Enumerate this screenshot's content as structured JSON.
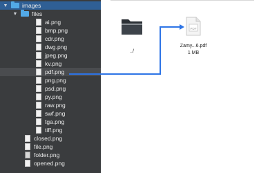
{
  "sidebar": {
    "folder_root": "images",
    "folder_files": "files",
    "files": [
      "ai.png",
      "bmp.png",
      "cdr.png",
      "dwg.png",
      "jpeg.png",
      "kv.png",
      "pdf.png",
      "png.png",
      "psd.png",
      "py.png",
      "raw.png",
      "swf.png",
      "tga.png",
      "tiff.png"
    ],
    "bottom_items": [
      "closed.png",
      "file.png",
      "folder.png",
      "opened.png"
    ]
  },
  "main": {
    "parent_label": "../",
    "pdf_name": "Zamy...6.pdf",
    "pdf_size": "1 MB",
    "pdf_badge": "PDF"
  },
  "colors": {
    "sidebar_bg": "#3a3c3e",
    "selected_bg": "#2f5f95",
    "folder_blue": "#52a9e6",
    "link_blue": "#2d74e6"
  }
}
